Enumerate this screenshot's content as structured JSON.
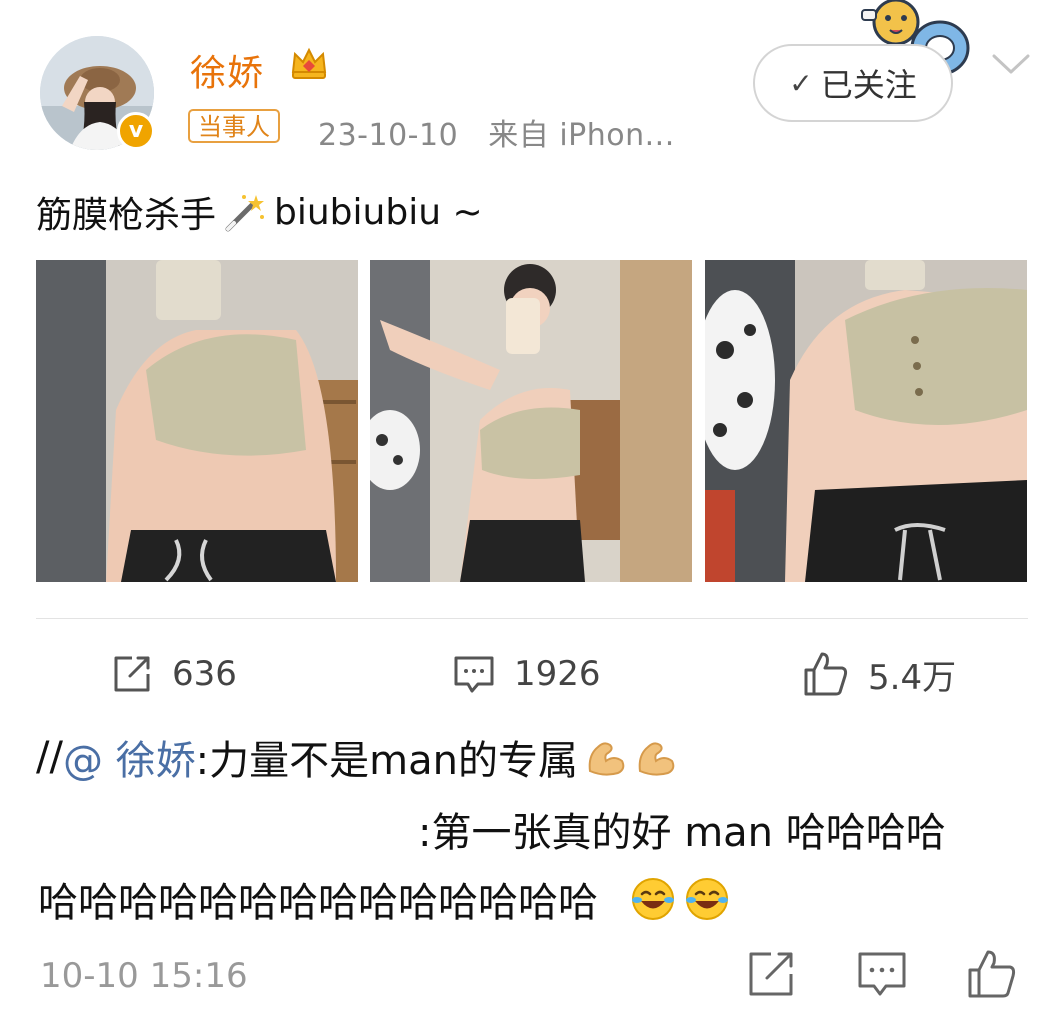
{
  "header": {
    "username": "徐娇",
    "role_badge": "当事人",
    "date": "23-10-10",
    "source": "来自 iPhon...",
    "follow_label": "已关注",
    "follow_check": "✓"
  },
  "post": {
    "text": "筋膜枪杀手",
    "text_suffix": "biubiubiu ~",
    "images": [
      {
        "name": "photo-1"
      },
      {
        "name": "photo-2"
      },
      {
        "name": "photo-3"
      }
    ]
  },
  "actions": {
    "repost_count": "636",
    "comment_count": "1926",
    "like_count": "5.4万"
  },
  "repost": {
    "prefix": "//",
    "mention": "@ 徐娇",
    "line1_text": ":力量不是man的专属",
    "line2_text": ":第一张真的好 man 哈哈哈哈",
    "line3_text": "哈哈哈哈哈哈哈哈哈哈哈哈哈哈"
  },
  "footer": {
    "timestamp": "10-10 15:16"
  },
  "colors": {
    "username": "#e8730a",
    "mention": "#4a6fa5",
    "meta": "#888888"
  }
}
